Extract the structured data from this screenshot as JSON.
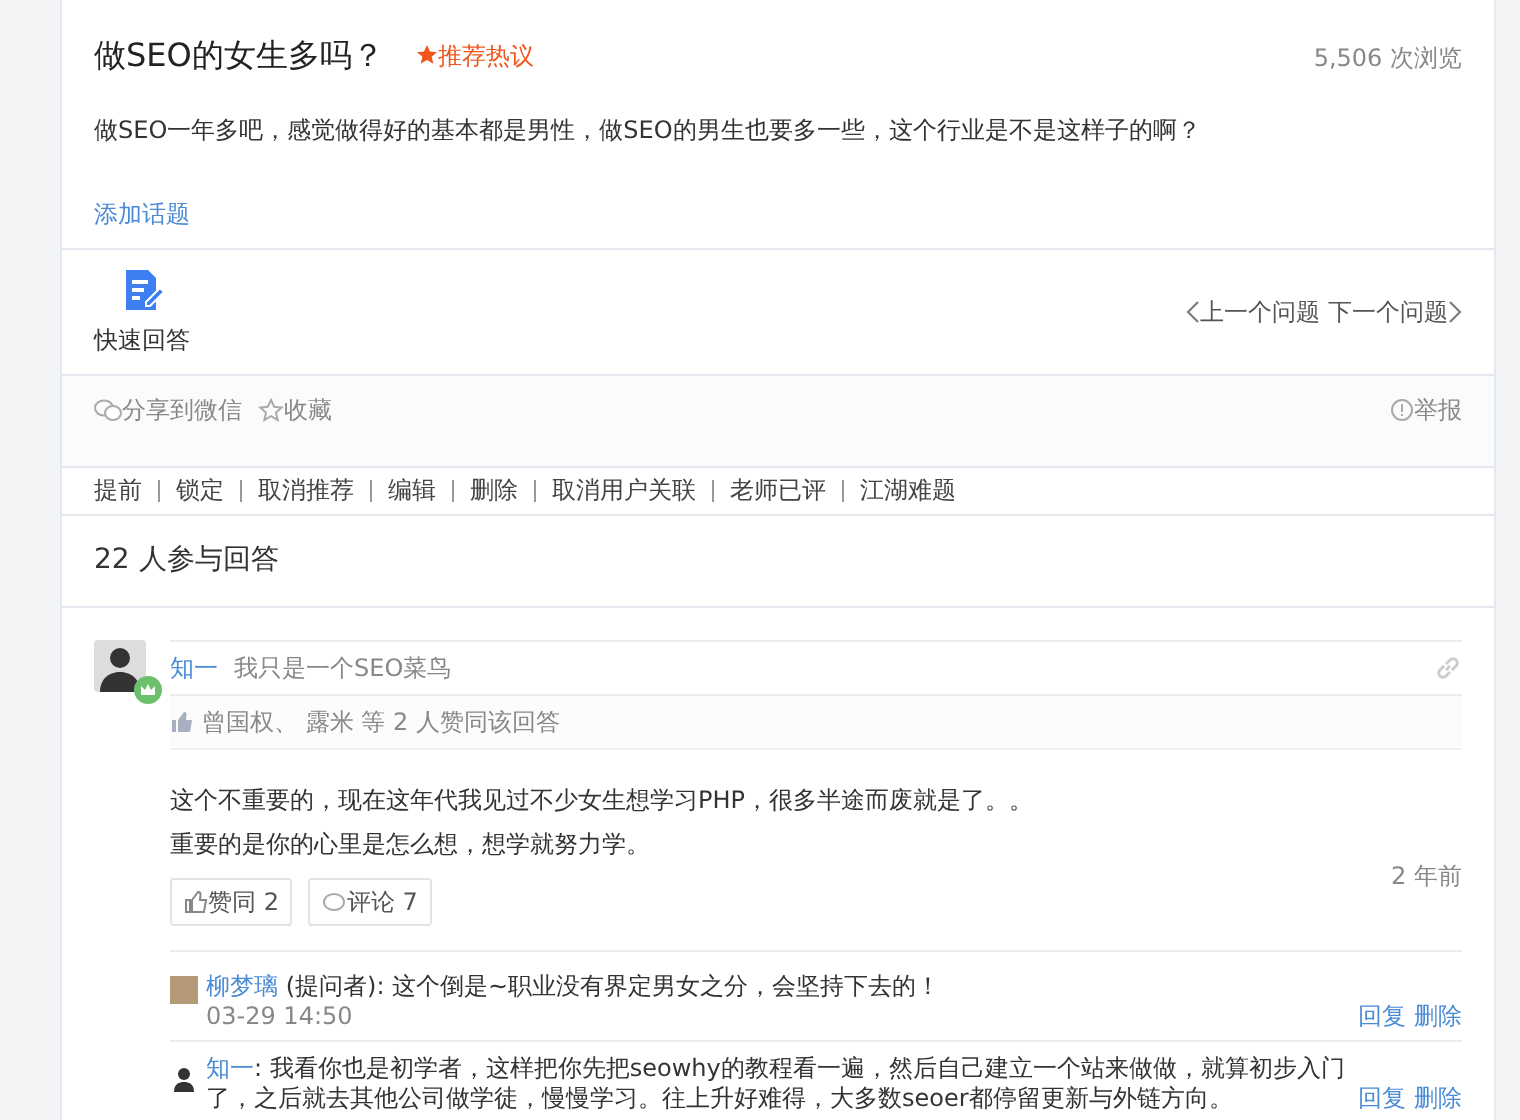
{
  "question": {
    "title": "做SEO的女生多吗？",
    "badge": "推荐热议",
    "views": "5,506 次浏览",
    "description": "做SEO一年多吧，感觉做得好的基本都是男性，做SEO的男生也要多一些，这个行业是不是这样子的啊？",
    "add_topic": "添加话题"
  },
  "actions": {
    "quick_answer": "快速回答",
    "prev": "上一个问题",
    "next": "下一个问题"
  },
  "share": {
    "wechat": "分享到微信",
    "favorite": "收藏",
    "report": "举报"
  },
  "admin_links": [
    "提前",
    "锁定",
    "取消推荐",
    "编辑",
    "删除",
    "取消用户关联",
    "老师已评",
    "江湖难题"
  ],
  "answers_header": "22 人参与回答",
  "answer": {
    "author": "知一",
    "signature": "我只是一个SEO菜鸟",
    "voters": "曾国权、 露米 等 2 人赞同该回答",
    "paragraphs": [
      "这个不重要的，现在这年代我见过不少女生想学习PHP，很多半途而废就是了。。",
      "重要的是你的心里是怎么想，想学就努力学。"
    ],
    "agree": "赞同 2",
    "comment": "评论 7",
    "time": "2 年前",
    "comments": [
      {
        "author": "柳梦璃",
        "role": "(提问者)",
        "text": ": 这个倒是~职业没有界定男女之分，会坚持下去的！",
        "time": "03-29 14:50",
        "actions": [
          "回复",
          "删除"
        ]
      },
      {
        "author": "知一",
        "text": ": 我看你也是初学者，这样把你先把seowhy的教程看一遍，然后自己建立一个站来做做，就算初步入门了，之后就去其他公司做学徒，慢慢学习。往上升好难得，大多数seoer都停留更新与外链方向。",
        "actions": [
          "回复",
          "删除"
        ]
      }
    ]
  }
}
